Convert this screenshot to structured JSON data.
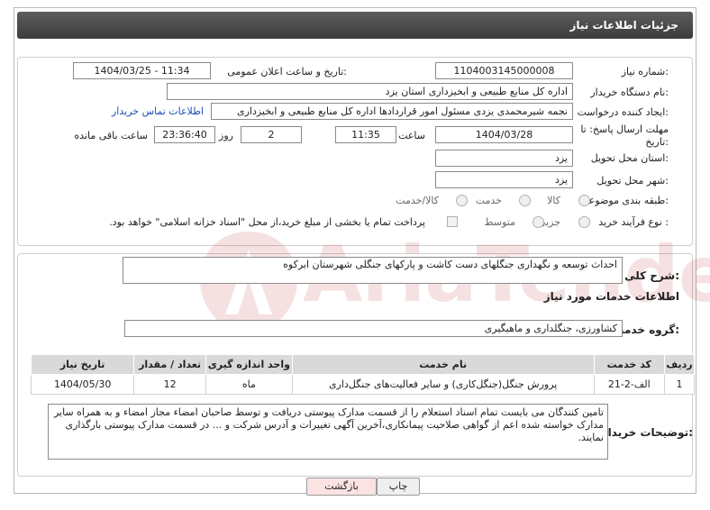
{
  "header": {
    "title": "جزئیات اطلاعات نیاز"
  },
  "form": {
    "need_number_label": "شماره نیاز:",
    "need_number": "1104003145000008",
    "announce_label": "تاریخ و ساعت اعلان عمومی:",
    "announce_value": "1404/03/25 - 11:34",
    "buyer_org_label": "نام دستگاه خریدار:",
    "buyer_org": "اداره کل منابع طبیعی و ابخیزداری استان یزد",
    "requester_label": "ایجاد کننده درخواست:",
    "requester": "نجمه شیرمحمدی یزدی مسئول امور قراردادها اداره کل منابع طبیعی و ابخیزداری",
    "contact_link": "اطلاعات تماس خریدار",
    "deadline_label": "مهلت ارسال پاسخ: تا تاریخ:",
    "deadline_date": "1404/03/28",
    "time_label": "ساعت",
    "deadline_time": "11:35",
    "days_value": "2",
    "days_label": "روز و",
    "remaining_time": "23:36:40",
    "remaining_label": "ساعت باقی مانده",
    "province_label": "استان محل تحویل:",
    "province": "یزد",
    "city_label": "شهر محل تحویل:",
    "city": "یزد",
    "category_label": "طبقه بندی موضوعی:",
    "category_options": [
      "کالا",
      "خدمت",
      "کالا/خدمت"
    ],
    "process_label": "نوع فرآیند خرید :",
    "process_options": [
      "جزیی",
      "متوسط"
    ],
    "payment_note": "پرداخت تمام یا بخشی از مبلغ خرید،از محل \"اسناد خزانه اسلامی\" خواهد بود."
  },
  "summary": {
    "label": "شرح کلی نیاز:",
    "text": "احداث توسعه و  نگهداری جنگلهای دست کاشت و پارکهای جنگلی شهرستان ابرکوه"
  },
  "services": {
    "section_title": "اطلاعات خدمات مورد نیاز",
    "group_label": "گروه خدمت:",
    "group_value": "کشاورزی، جنگلداری و ماهیگیری",
    "columns": [
      "ردیف",
      "کد خدمت",
      "نام خدمت",
      "واحد اندازه گیری",
      "تعداد / مقدار",
      "تاریخ نیاز"
    ],
    "rows": [
      [
        "1",
        "الف-2-21",
        "پرورش جنگل(جنگل‌کاری) و سایر فعالیت‌های جنگل‌داری",
        "ماه",
        "12",
        "1404/05/30"
      ]
    ]
  },
  "notes": {
    "label": "توضیحات خریدار:",
    "text": "تامین کنندگان می بایست تمام اسناد استعلام را از قسمت مدارک پیوستی دریافت و توسط صاحبان امضاء مجاز امضاء و به همراه سایر مدارک خواسته شده اعم از گواهی صلاحیت پیمانکاری،آخرین آگهی تغییرات و آدرس شرکت و ... در قسمت مدارک پیوستی بارگذاری نمایند."
  },
  "buttons": {
    "print": "چاپ",
    "back": "بازگشت"
  },
  "watermark": {
    "text": "AriaTender.neT"
  },
  "colors": {
    "title_bg": "#4a4a4a",
    "link": "#1a4fb5",
    "back_bg": "#fbe3e3",
    "watermark": "#b01010"
  }
}
